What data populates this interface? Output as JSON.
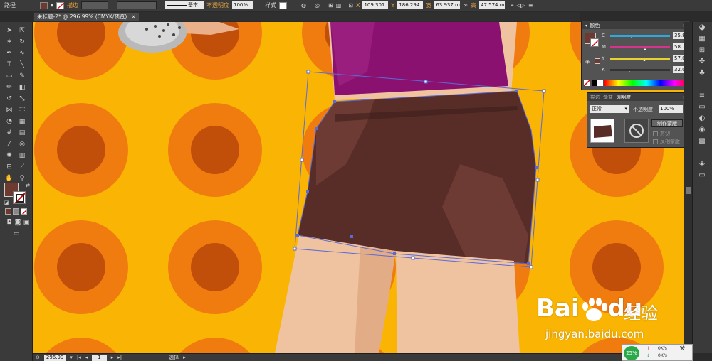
{
  "control_bar": {
    "selection_type": "路径",
    "stroke_label": "描边",
    "stroke_style": "基本",
    "opacity_label": "不透明度",
    "opacity_value": "100%",
    "style_label": "样式",
    "x_label": "X",
    "x_value": "109.301",
    "y_label": "Y",
    "y_value": "186.294",
    "w_label": "宽",
    "w_value": "63.937 m",
    "h_label": "高",
    "h_value": "47.574 m"
  },
  "document_tab": {
    "title": "未标题-2* @ 296.99% (CMYK/预览)",
    "close": "×"
  },
  "color_panel": {
    "title": "颜色",
    "channels": [
      {
        "name": "C",
        "value": "35.86",
        "unit": "%",
        "level": 0.3586,
        "track": "#2ca9df"
      },
      {
        "name": "M",
        "value": "58.71",
        "unit": "%",
        "level": 0.5871,
        "track": "#d6338a"
      },
      {
        "name": "Y",
        "value": "57.01",
        "unit": "%",
        "level": 0.5701,
        "track": "#e8d230"
      },
      {
        "name": "K",
        "value": "32.05",
        "unit": "%",
        "level": 0.3205,
        "track": "#333333"
      }
    ]
  },
  "transparency_panel": {
    "tabs": [
      "描边",
      "渐变",
      "透明度"
    ],
    "blend_mode": "正常",
    "opacity_label": "不透明度",
    "opacity_value": "100%",
    "make_mask_button": "制作蒙版",
    "clip_label": "剪切",
    "invert_mask_label": "反相蒙版"
  },
  "status_bar": {
    "zoom": "296.99",
    "page": "1",
    "tool_name": "选择"
  },
  "network_widget": {
    "percent": "25%",
    "up": "0K/s",
    "down": "0K/s"
  },
  "watermark": {
    "brand": "Bai",
    "brand2": "du",
    "chinese": "经验",
    "url": "jingyan.baidu.com"
  },
  "colors": {
    "fill": "#6e3a2f",
    "shorts": "#582d28",
    "shirt": "#8b1170",
    "skin": "#efc2a0",
    "background": "#fab403",
    "ring": "#f07c10",
    "dot": "#c14f0a",
    "selection": "#5a6bd8"
  }
}
